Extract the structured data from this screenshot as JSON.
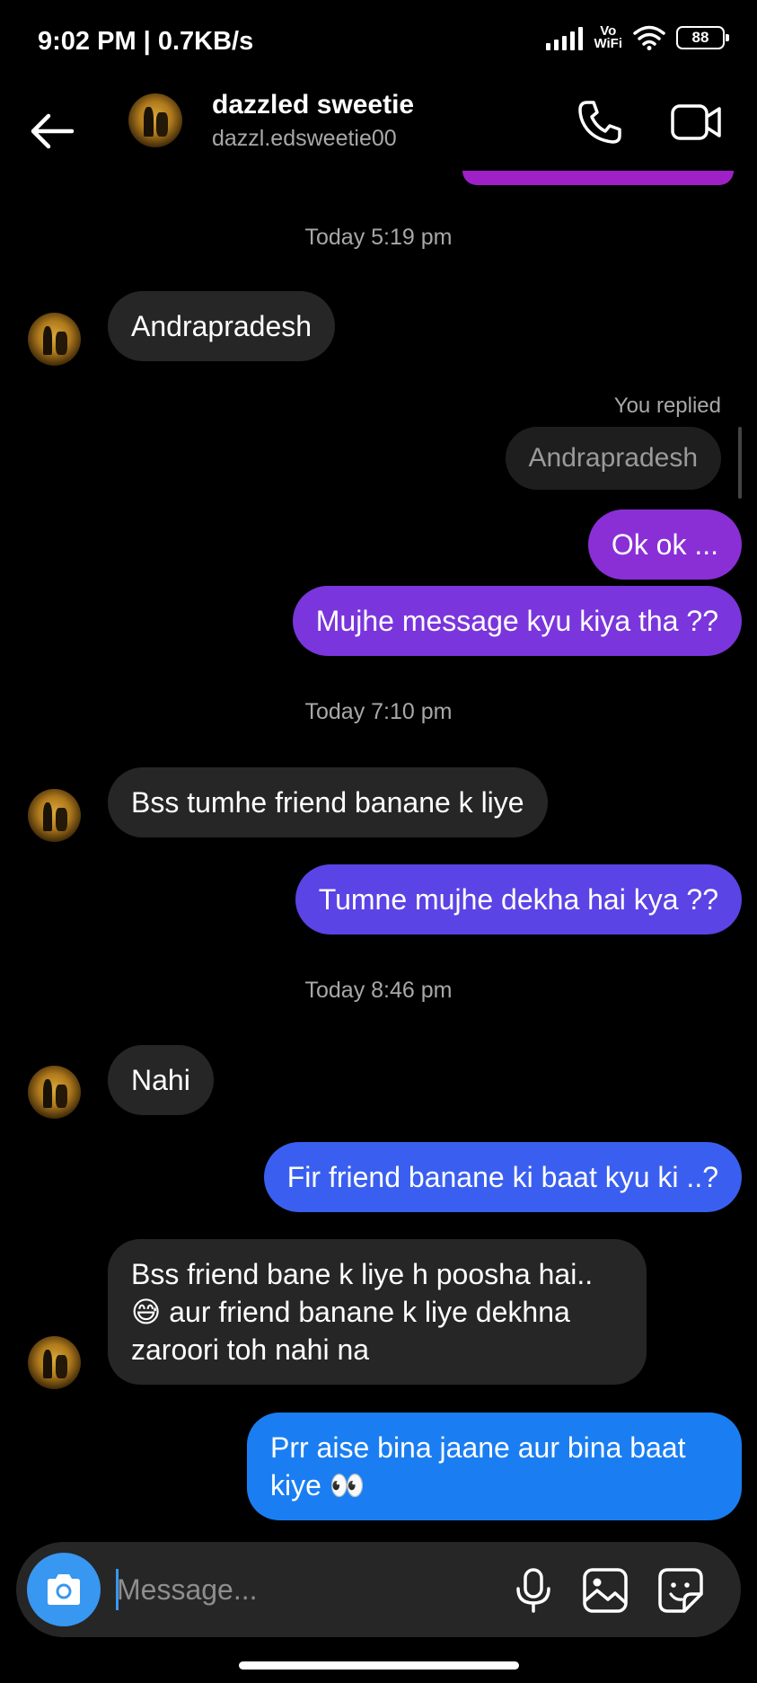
{
  "status_bar": {
    "time_speed": "9:02 PM | 0.7KB/s",
    "network_label_top": "Vo",
    "network_label_bottom": "WiFi",
    "battery": "88"
  },
  "header": {
    "name": "dazzled sweetie",
    "handle": "dazzl.edsweetie00"
  },
  "chat": {
    "timestamps": [
      "Today 5:19 pm",
      "Today 7:10 pm",
      "Today 8:46 pm"
    ],
    "reply_label": "You replied",
    "reply_quote": "Andrapradesh",
    "messages": [
      {
        "from": "them",
        "text": "Andrapradesh"
      },
      {
        "from": "me",
        "text": "Ok ok ..."
      },
      {
        "from": "me",
        "text": "Mujhe message kyu kiya tha ??"
      },
      {
        "from": "them",
        "text": "Bss tumhe friend banane k liye"
      },
      {
        "from": "me",
        "text": "Tumne mujhe dekha hai kya ??"
      },
      {
        "from": "them",
        "text": "Nahi"
      },
      {
        "from": "me",
        "text": "Fir friend banane ki baat kyu ki ..?"
      },
      {
        "from": "them",
        "lines": [
          "Bss friend bane k liye h poosha hai..",
          "😅 aur friend banane k liye dekhna",
          "zaroori toh nahi na"
        ]
      },
      {
        "from": "me",
        "lines": [
          "Prr aise bina jaane aur bina baat",
          "kiye 👀"
        ]
      }
    ]
  },
  "composer": {
    "placeholder": "Message..."
  },
  "colors": {
    "bubble_purple": "#8a2fd6",
    "bubble_violet": "#6a3fe0",
    "bubble_indigo": "#5146e8",
    "bubble_blue": "#3a5ff0",
    "bubble_bright_blue": "#1a7ef2",
    "incoming": "#262626",
    "accent": "#3897f0"
  },
  "icons": [
    "back-arrow-icon",
    "phone-icon",
    "video-camera-icon",
    "camera-icon",
    "microphone-icon",
    "gallery-icon",
    "sticker-icon"
  ]
}
